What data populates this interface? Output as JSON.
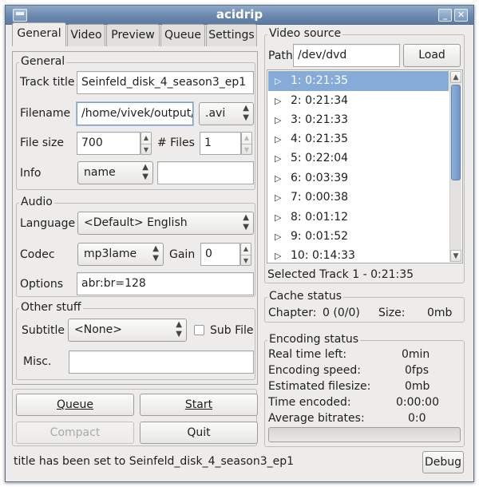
{
  "window": {
    "title": "acidrip"
  },
  "tabs": [
    {
      "label": "General",
      "active": true
    },
    {
      "label": "Video",
      "active": false
    },
    {
      "label": "Preview",
      "active": false
    },
    {
      "label": "Queue",
      "active": false
    },
    {
      "label": "Settings",
      "active": false
    }
  ],
  "general": {
    "section_label": "General",
    "track_title_label": "Track title",
    "track_title_value": "Seinfeld_disk_4_season3_ep1",
    "filename_label": "Filename",
    "filename_value": "/home/vivek/output/",
    "extension_value": ".avi",
    "filesize_label": "File size",
    "filesize_value": "700",
    "files_label": "# Files",
    "files_value": "1",
    "info_label": "Info",
    "info_value": "name",
    "info_text_value": ""
  },
  "audio": {
    "section_label": "Audio",
    "language_label": "Language",
    "language_value": "<Default> English",
    "codec_label": "Codec",
    "codec_value": "mp3lame",
    "gain_label": "Gain",
    "gain_value": "0",
    "options_label": "Options",
    "options_value": "abr:br=128"
  },
  "other": {
    "section_label": "Other stuff",
    "subtitle_label": "Subtitle",
    "subtitle_value": "<None>",
    "subfile_label": "Sub File",
    "subfile_checked": false,
    "misc_label": "Misc.",
    "misc_value": ""
  },
  "buttons": {
    "queue": "Queue",
    "start": "Start",
    "compact": "Compact",
    "quit": "Quit",
    "load": "Load",
    "debug": "Debug"
  },
  "video_source": {
    "section_label": "Video source",
    "path_label": "Path",
    "path_value": "/dev/dvd",
    "tracks": [
      {
        "label": "1: 0:21:35",
        "selected": true
      },
      {
        "label": "2: 0:21:34",
        "selected": false
      },
      {
        "label": "3: 0:21:33",
        "selected": false
      },
      {
        "label": "4: 0:21:35",
        "selected": false
      },
      {
        "label": "5: 0:22:04",
        "selected": false
      },
      {
        "label": "6: 0:03:39",
        "selected": false
      },
      {
        "label": "7: 0:00:38",
        "selected": false
      },
      {
        "label": "8: 0:01:12",
        "selected": false
      },
      {
        "label": "9: 0:01:52",
        "selected": false
      },
      {
        "label": "10: 0:14:33",
        "selected": false
      }
    ],
    "selected_text": "Selected Track 1 - 0:21:35"
  },
  "cache_status": {
    "section_label": "Cache status",
    "chapter_label": "Chapter:",
    "chapter_value": "0 (0/0)",
    "size_label": "Size:",
    "size_value": "0mb"
  },
  "encoding_status": {
    "section_label": "Encoding status",
    "rows": [
      {
        "label": "Real time left:",
        "value": "0min"
      },
      {
        "label": "Encoding speed:",
        "value": "0fps"
      },
      {
        "label": "Estimated filesize:",
        "value": "0mb"
      },
      {
        "label": "Time encoded:",
        "value": "0:00:00"
      },
      {
        "label": "Average bitrates:",
        "value": "0:0"
      }
    ],
    "progress": 0
  },
  "status": {
    "message": "title has been set to Seinfeld_disk_4_season3_ep1"
  },
  "icons": {
    "window_menu": "window-menu-icon",
    "minimize": "minimize-icon",
    "close": "close-icon",
    "track_expand": "triangle-right-icon"
  }
}
